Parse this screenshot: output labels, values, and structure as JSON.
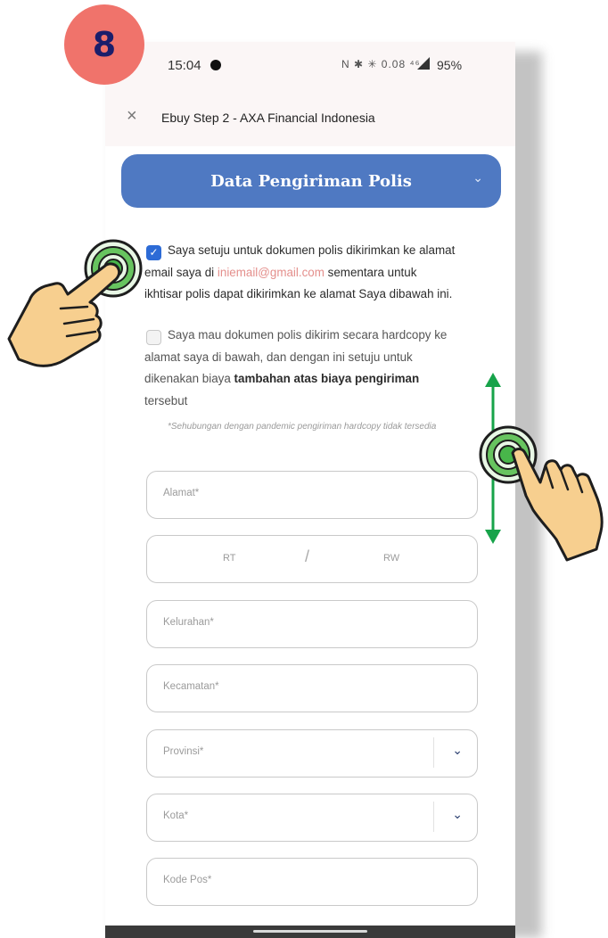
{
  "step_badge": "8",
  "status_bar": {
    "time": "15:04",
    "icons": "N ✱ ✳ 0.08 ⁴⁶",
    "battery": "95%"
  },
  "app_bar": {
    "close_icon": "×",
    "title": "Ebuy Step 2 - AXA Financial Indonesia"
  },
  "section": {
    "title": "Data Pengiriman Polis",
    "chevron": "⌄"
  },
  "consent_email": {
    "checked": true,
    "text_before": "Saya setuju untuk dokumen polis dikirimkan ke alamat email saya di",
    "email": "iniemail@gmail.com",
    "text_after": "sementara untuk ikhtisar polis dapat dikirimkan ke alamat Saya dibawah ini."
  },
  "consent_hardcopy": {
    "checked": false,
    "text_before": "Saya mau dokumen polis dikirim secara hardcopy ke alamat saya di bawah, dan dengan ini setuju untuk dikenakan biaya",
    "bold": "tambahan atas biaya pengiriman",
    "text_after": "tersebut"
  },
  "note": "*Sehubungan dengan pandemic pengiriman hardcopy tidak tersedia",
  "form": {
    "alamat_placeholder": "Alamat*",
    "rt_placeholder": "RT",
    "slash": "/",
    "rw_placeholder": "RW",
    "kelurahan_placeholder": "Kelurahan*",
    "kecamatan_placeholder": "Kecamatan*",
    "provinsi_placeholder": "Provinsi*",
    "kota_placeholder": "Kota*",
    "kodepos_placeholder": "Kode Pos*",
    "dropdown_icon": "⌄"
  },
  "colors": {
    "badge": "#f0736b",
    "header": "#4f79c2",
    "checkbox": "#2d6bd6",
    "email": "#e48f8c",
    "gesture_ring": "#48b64a",
    "scroll_arrow": "#17a34a",
    "hand": "#f7cf8f"
  },
  "icons": [
    "tap-gesture-icon",
    "scroll-gesture-icon",
    "checkbox-checked-icon",
    "chevron-down-icon",
    "close-icon"
  ]
}
